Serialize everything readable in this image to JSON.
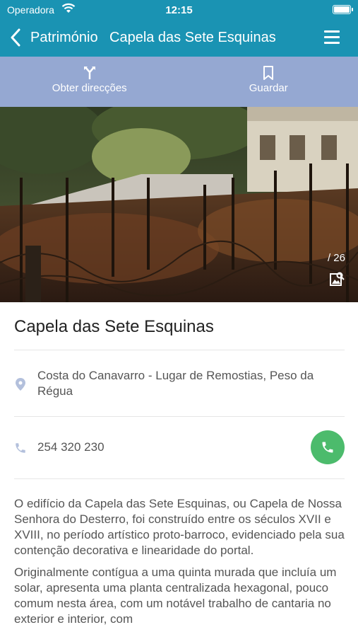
{
  "status_bar": {
    "carrier": "Operadora",
    "time": "12:15"
  },
  "nav": {
    "back_label": "Património",
    "title": "Capela das Sete Esquinas"
  },
  "actions": {
    "directions_label": "Obter direcções",
    "save_label": "Guardar"
  },
  "photo": {
    "count": "/ 26"
  },
  "place": {
    "name": "Capela das Sete Esquinas",
    "address": "Costa do Canavarro - Lugar de Remostias, Peso da Régua",
    "phone": "254 320 230"
  },
  "description": {
    "p1": "O edifício da Capela das Sete Esquinas, ou Capela de Nossa Senhora do Desterro, foi construído entre os séculos XVII e XVIII, no período artístico proto-barroco, evidenciado pela sua contenção decorativa e linearidade do portal.",
    "p2": "Originalmente contígua a uma quinta murada que incluía um solar, apresenta uma planta centralizada hexagonal, pouco comum nesta área, com um notável trabalho de cantaria no exterior e interior, com"
  },
  "colors": {
    "header": "#1a93b3",
    "action_bar": "#95a8d2",
    "call_button": "#4cbb6c"
  }
}
